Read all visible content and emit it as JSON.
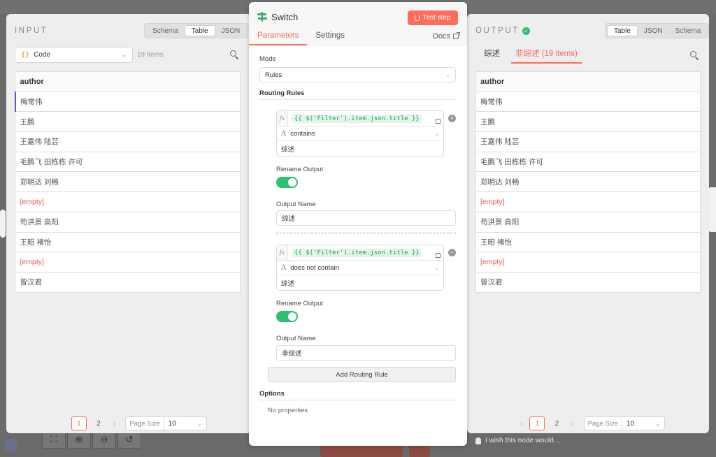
{
  "input_panel": {
    "title": "INPUT",
    "view_options": [
      "Schema",
      "Table",
      "JSON"
    ],
    "active_view": "Table",
    "node_select": {
      "icon": "{}",
      "value": "Code"
    },
    "items_count": "19 items",
    "table": {
      "header": "author",
      "rows": [
        "梅常伟",
        "王鹏",
        "王嘉伟 陆芸",
        "毛鹏飞 田栋栋 许可",
        "郑明达 刘畅",
        "[empty]",
        "苟洪景 高阳",
        "王昭 褚怡",
        "[empty]",
        "曾汉君"
      ]
    },
    "pagination": {
      "pages": [
        "1",
        "2"
      ],
      "current": "1",
      "next": "›",
      "page_size_label": "Page Size",
      "page_size": "10"
    }
  },
  "output_panel": {
    "title": "OUTPUT",
    "view_options": [
      "Table",
      "JSON",
      "Schema"
    ],
    "active_view": "Table",
    "tabs": [
      "综述",
      "非综述 (19 items)"
    ],
    "active_tab": "非综述 (19 items)",
    "table": {
      "header": "author",
      "rows": [
        "梅常伟",
        "王鹏",
        "王嘉伟 陆芸",
        "毛鹏飞 田栋栋 许可",
        "郑明达 刘畅",
        "[empty]",
        "苟洪景 高阳",
        "王昭 褚怡",
        "[empty]",
        "曾汉君"
      ]
    },
    "pagination": {
      "pages": [
        "1",
        "2"
      ],
      "current": "1",
      "prev": "‹",
      "next": "›",
      "page_size_label": "Page Size",
      "page_size": "10"
    }
  },
  "node": {
    "title": "Switch",
    "test_button": "Test step",
    "tabs": [
      "Parameters",
      "Settings"
    ],
    "active_tab": "Parameters",
    "docs_label": "Docs",
    "mode_label": "Mode",
    "mode_value": "Rules",
    "routing_rules_label": "Routing Rules",
    "rules": [
      {
        "fx": "fx",
        "expression": "{{ $('Filter').item.json.title }}",
        "operator": "contains",
        "value": "综述",
        "rename_label": "Rename Output",
        "rename_on": true,
        "output_name_label": "Output Name",
        "output_name": "综述"
      },
      {
        "fx": "fx",
        "expression": "{{ $('Filter').item.json.title }}",
        "operator": "does not contain",
        "value": "综述",
        "rename_label": "Rename Output",
        "rename_on": true,
        "output_name_label": "Output Name",
        "output_name": "非综述"
      }
    ],
    "add_rule_label": "Add Routing Rule",
    "options_label": "Options",
    "no_properties": "No properties"
  },
  "canvas": {
    "feedback_text": "I wish this node would..."
  },
  "colors": {
    "accent": "#ff6d5a",
    "success": "#2fbf71",
    "expression": "#1c9e5a"
  }
}
